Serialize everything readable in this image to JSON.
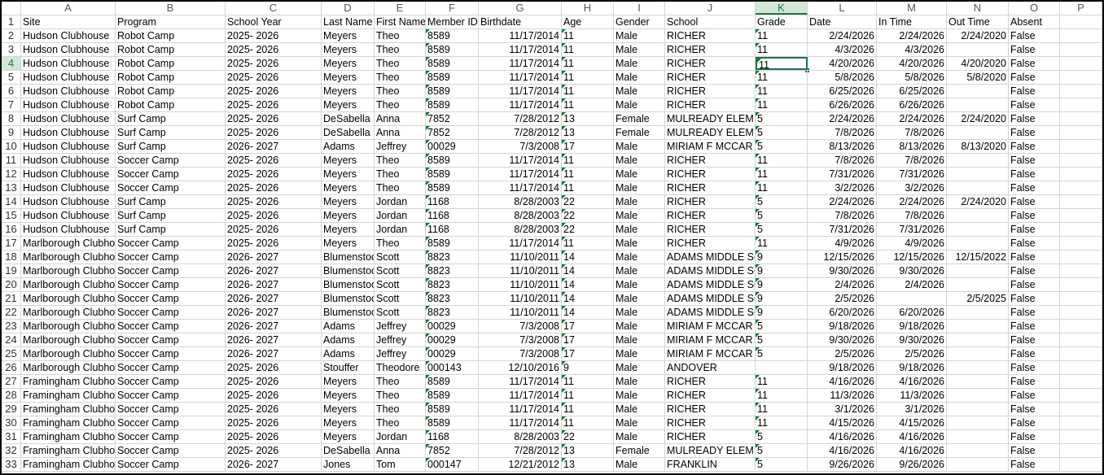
{
  "column_letters": [
    "A",
    "B",
    "C",
    "D",
    "E",
    "F",
    "G",
    "H",
    "I",
    "J",
    "K",
    "L",
    "M",
    "N",
    "O",
    "P"
  ],
  "selected_column": "K",
  "selected_row": "4",
  "rows": [
    [
      "1",
      "Site",
      "Program",
      "School Year",
      "Last Name",
      "First Name",
      "Member ID",
      "Birthdate",
      "Age",
      "Gender",
      "School",
      "Grade",
      "Date",
      "In Time",
      "Out Time",
      "Absent"
    ],
    [
      "2",
      "Hudson Clubhouse",
      "Robot Camp",
      "2025- 2026",
      "Meyers",
      "Theo",
      "8589",
      "11/17/2014",
      "11",
      "Male",
      "RICHER",
      "11",
      "2/24/2026",
      "2/24/2026",
      "2/24/2020",
      "False"
    ],
    [
      "3",
      "Hudson Clubhouse",
      "Robot Camp",
      "2025- 2026",
      "Meyers",
      "Theo",
      "8589",
      "11/17/2014",
      "11",
      "Male",
      "RICHER",
      "11",
      "4/3/2026",
      "4/3/2026",
      "",
      "False"
    ],
    [
      "4",
      "Hudson Clubhouse",
      "Robot Camp",
      "2025- 2026",
      "Meyers",
      "Theo",
      "8589",
      "11/17/2014",
      "11",
      "Male",
      "RICHER",
      "11",
      "4/20/2026",
      "4/20/2026",
      "4/20/2020",
      "False"
    ],
    [
      "5",
      "Hudson Clubhouse",
      "Robot Camp",
      "2025- 2026",
      "Meyers",
      "Theo",
      "8589",
      "11/17/2014",
      "11",
      "Male",
      "RICHER",
      "11",
      "5/8/2026",
      "5/8/2026",
      "5/8/2020",
      "False"
    ],
    [
      "6",
      "Hudson Clubhouse",
      "Robot Camp",
      "2025- 2026",
      "Meyers",
      "Theo",
      "8589",
      "11/17/2014",
      "11",
      "Male",
      "RICHER",
      "11",
      "6/25/2026",
      "6/25/2026",
      "",
      "False"
    ],
    [
      "7",
      "Hudson Clubhouse",
      "Robot Camp",
      "2025- 2026",
      "Meyers",
      "Theo",
      "8589",
      "11/17/2014",
      "11",
      "Male",
      "RICHER",
      "11",
      "6/26/2026",
      "6/26/2026",
      "",
      "False"
    ],
    [
      "8",
      "Hudson Clubhouse",
      "Surf Camp",
      "2025- 2026",
      "DeSabella",
      "Anna",
      "7852",
      "7/28/2012",
      "13",
      "Female",
      "MULREADY ELEM",
      "5",
      "2/24/2026",
      "2/24/2026",
      "2/24/2020",
      "False"
    ],
    [
      "9",
      "Hudson Clubhouse",
      "Surf Camp",
      "2025- 2026",
      "DeSabella",
      "Anna",
      "7852",
      "7/28/2012",
      "13",
      "Female",
      "MULREADY ELEM",
      "5",
      "7/8/2026",
      "7/8/2026",
      "",
      "False"
    ],
    [
      "10",
      "Hudson Clubhouse",
      "Surf Camp",
      "2026- 2027",
      "Adams",
      "Jeffrey",
      "00029",
      "7/3/2008",
      "17",
      "Male",
      "MIRIAM F MCCAR",
      "5",
      "8/13/2026",
      "8/13/2026",
      "8/13/2020",
      "False"
    ],
    [
      "11",
      "Hudson Clubhouse",
      "Soccer Camp",
      "2025- 2026",
      "Meyers",
      "Theo",
      "8589",
      "11/17/2014",
      "11",
      "Male",
      "RICHER",
      "11",
      "7/8/2026",
      "7/8/2026",
      "",
      "False"
    ],
    [
      "12",
      "Hudson Clubhouse",
      "Soccer Camp",
      "2025- 2026",
      "Meyers",
      "Theo",
      "8589",
      "11/17/2014",
      "11",
      "Male",
      "RICHER",
      "11",
      "7/31/2026",
      "7/31/2026",
      "",
      "False"
    ],
    [
      "13",
      "Hudson Clubhouse",
      "Soccer Camp",
      "2025- 2026",
      "Meyers",
      "Theo",
      "8589",
      "11/17/2014",
      "11",
      "Male",
      "RICHER",
      "11",
      "3/2/2026",
      "3/2/2026",
      "",
      "False"
    ],
    [
      "14",
      "Hudson Clubhouse",
      "Surf Camp",
      "2025- 2026",
      "Meyers",
      "Jordan",
      "1168",
      "8/28/2003",
      "22",
      "Male",
      "RICHER",
      "5",
      "2/24/2026",
      "2/24/2026",
      "2/24/2020",
      "False"
    ],
    [
      "15",
      "Hudson Clubhouse",
      "Surf Camp",
      "2025- 2026",
      "Meyers",
      "Jordan",
      "1168",
      "8/28/2003",
      "22",
      "Male",
      "RICHER",
      "5",
      "7/8/2026",
      "7/8/2026",
      "",
      "False"
    ],
    [
      "16",
      "Hudson Clubhouse",
      "Surf Camp",
      "2025- 2026",
      "Meyers",
      "Jordan",
      "1168",
      "8/28/2003",
      "22",
      "Male",
      "RICHER",
      "5",
      "7/31/2026",
      "7/31/2026",
      "",
      "False"
    ],
    [
      "17",
      "Marlborough Clubhouse",
      "Soccer Camp",
      "2025- 2026",
      "Meyers",
      "Theo",
      "8589",
      "11/17/2014",
      "11",
      "Male",
      "RICHER",
      "11",
      "4/9/2026",
      "4/9/2026",
      "",
      "False"
    ],
    [
      "18",
      "Marlborough Clubhouse",
      "Soccer Camp",
      "2026- 2027",
      "Blumenstock",
      "Scott",
      "8823",
      "11/10/2011",
      "14",
      "Male",
      "ADAMS MIDDLE SCHOOL",
      "9",
      "12/15/2026",
      "12/15/2026",
      "12/15/2022",
      "False"
    ],
    [
      "19",
      "Marlborough Clubhouse",
      "Soccer Camp",
      "2026- 2027",
      "Blumenstock",
      "Scott",
      "8823",
      "11/10/2011",
      "14",
      "Male",
      "ADAMS MIDDLE SCHOOL",
      "9",
      "9/30/2026",
      "9/30/2026",
      "",
      "False"
    ],
    [
      "20",
      "Marlborough Clubhouse",
      "Soccer Camp",
      "2026- 2027",
      "Blumenstock",
      "Scott",
      "8823",
      "11/10/2011",
      "14",
      "Male",
      "ADAMS MIDDLE SCHOOL",
      "9",
      "2/4/2026",
      "2/4/2026",
      "",
      "False"
    ],
    [
      "21",
      "Marlborough Clubhouse",
      "Soccer Camp",
      "2026- 2027",
      "Blumenstock",
      "Scott",
      "8823",
      "11/10/2011",
      "14",
      "Male",
      "ADAMS MIDDLE SCHOOL",
      "9",
      "2/5/2026",
      "",
      "2/5/2025",
      "False"
    ],
    [
      "22",
      "Marlborough Clubhouse",
      "Soccer Camp",
      "2026- 2027",
      "Blumenstock",
      "Scott",
      "8823",
      "11/10/2011",
      "14",
      "Male",
      "ADAMS MIDDLE SCHOOL",
      "9",
      "6/20/2026",
      "6/20/2026",
      "",
      "False"
    ],
    [
      "23",
      "Marlborough Clubhouse",
      "Soccer Camp",
      "2026- 2027",
      "Adams",
      "Jeffrey",
      "00029",
      "7/3/2008",
      "17",
      "Male",
      "MIRIAM F MCCAR",
      "5",
      "9/18/2026",
      "9/18/2026",
      "",
      "False"
    ],
    [
      "24",
      "Marlborough Clubhouse",
      "Soccer Camp",
      "2026- 2027",
      "Adams",
      "Jeffrey",
      "00029",
      "7/3/2008",
      "17",
      "Male",
      "MIRIAM F MCCAR",
      "5",
      "9/30/2026",
      "9/30/2026",
      "",
      "False"
    ],
    [
      "25",
      "Marlborough Clubhouse",
      "Soccer Camp",
      "2026- 2027",
      "Adams",
      "Jeffrey",
      "00029",
      "7/3/2008",
      "17",
      "Male",
      "MIRIAM F MCCAR",
      "5",
      "2/5/2026",
      "2/5/2026",
      "",
      "False"
    ],
    [
      "26",
      "Marlborough Clubhouse",
      "Soccer Camp",
      "2025- 2026",
      "Stouffer",
      "Theodore",
      "000143",
      "12/10/2016",
      "9",
      "Male",
      "ANDOVER",
      "",
      "9/18/2026",
      "9/18/2026",
      "",
      "False"
    ],
    [
      "27",
      "Framingham Clubhouse",
      "Soccer Camp",
      "2025- 2026",
      "Meyers",
      "Theo",
      "8589",
      "11/17/2014",
      "11",
      "Male",
      "RICHER",
      "11",
      "4/16/2026",
      "4/16/2026",
      "",
      "False"
    ],
    [
      "28",
      "Framingham Clubhouse",
      "Soccer Camp",
      "2025- 2026",
      "Meyers",
      "Theo",
      "8589",
      "11/17/2014",
      "11",
      "Male",
      "RICHER",
      "11",
      "11/3/2026",
      "11/3/2026",
      "",
      "False"
    ],
    [
      "29",
      "Framingham Clubhouse",
      "Soccer Camp",
      "2025- 2026",
      "Meyers",
      "Theo",
      "8589",
      "11/17/2014",
      "11",
      "Male",
      "RICHER",
      "11",
      "3/1/2026",
      "3/1/2026",
      "",
      "False"
    ],
    [
      "30",
      "Framingham Clubhouse",
      "Soccer Camp",
      "2025- 2026",
      "Meyers",
      "Theo",
      "8589",
      "11/17/2014",
      "11",
      "Male",
      "RICHER",
      "11",
      "4/15/2026",
      "4/15/2026",
      "",
      "False"
    ],
    [
      "31",
      "Framingham Clubhouse",
      "Soccer Camp",
      "2025- 2026",
      "Meyers",
      "Jordan",
      "1168",
      "8/28/2003",
      "22",
      "Male",
      "RICHER",
      "5",
      "4/16/2026",
      "4/16/2026",
      "",
      "False"
    ],
    [
      "32",
      "Framingham Clubhouse",
      "Soccer Camp",
      "2025- 2026",
      "DeSabella",
      "Anna",
      "7852",
      "7/28/2012",
      "13",
      "Female",
      "MULREADY ELEM",
      "5",
      "4/16/2026",
      "4/16/2026",
      "",
      "False"
    ],
    [
      "33",
      "Framingham Clubhouse",
      "Soccer Camp",
      "2026- 2027",
      "Jones",
      "Tom",
      "000147",
      "12/21/2012",
      "13",
      "Male",
      "FRANKLIN",
      "5",
      "9/26/2026",
      "9/26/2026",
      "",
      "False"
    ]
  ]
}
